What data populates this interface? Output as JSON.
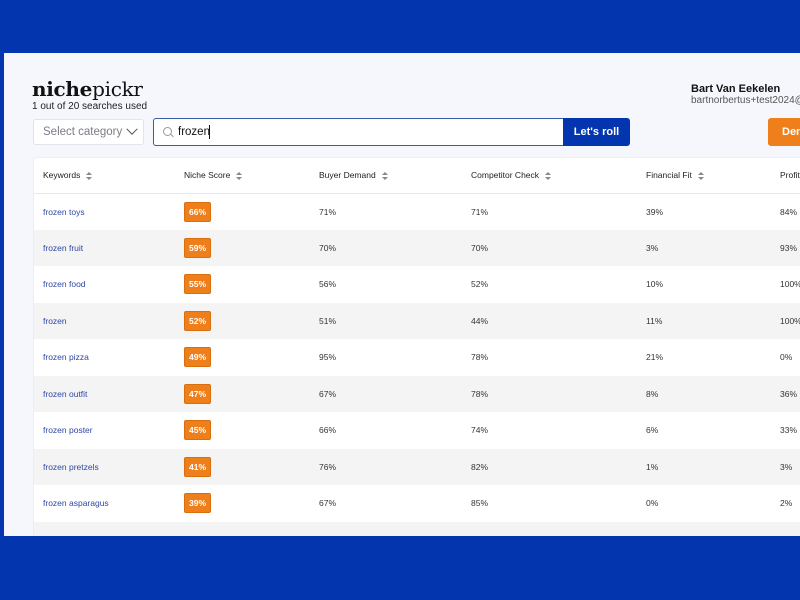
{
  "app": {
    "logo_bold": "niche",
    "logo_light": "pickr",
    "usage": "1 out of 20 searches used"
  },
  "user": {
    "name": "Bart Van Eekelen",
    "email": "bartnorbertus+test2024@"
  },
  "controls": {
    "category_placeholder": "Select category",
    "search_value": "frozen",
    "submit_label": "Let's roll",
    "demo_label": "Demo"
  },
  "colors": {
    "brand_blue": "#0336ae",
    "accent_orange": "#ef7f1a",
    "link_blue": "#2c47a3"
  },
  "table": {
    "columns": [
      "Keywords",
      "Niche Score",
      "Buyer Demand",
      "Competitor Check",
      "Financial Fit",
      "Profit"
    ],
    "rows": [
      {
        "keyword": "frozen toys",
        "niche_score": "66%",
        "buyer_demand": "71%",
        "competitor_check": "71%",
        "financial_fit": "39%",
        "profit": "84%"
      },
      {
        "keyword": "frozen fruit",
        "niche_score": "59%",
        "buyer_demand": "70%",
        "competitor_check": "70%",
        "financial_fit": "3%",
        "profit": "93%"
      },
      {
        "keyword": "frozen food",
        "niche_score": "55%",
        "buyer_demand": "56%",
        "competitor_check": "52%",
        "financial_fit": "10%",
        "profit": "100%"
      },
      {
        "keyword": "frozen",
        "niche_score": "52%",
        "buyer_demand": "51%",
        "competitor_check": "44%",
        "financial_fit": "11%",
        "profit": "100%"
      },
      {
        "keyword": "frozen pizza",
        "niche_score": "49%",
        "buyer_demand": "95%",
        "competitor_check": "78%",
        "financial_fit": "21%",
        "profit": "0%"
      },
      {
        "keyword": "frozen outfit",
        "niche_score": "47%",
        "buyer_demand": "67%",
        "competitor_check": "78%",
        "financial_fit": "8%",
        "profit": "36%"
      },
      {
        "keyword": "frozen poster",
        "niche_score": "45%",
        "buyer_demand": "66%",
        "competitor_check": "74%",
        "financial_fit": "6%",
        "profit": "33%"
      },
      {
        "keyword": "frozen pretzels",
        "niche_score": "41%",
        "buyer_demand": "76%",
        "competitor_check": "82%",
        "financial_fit": "1%",
        "profit": "3%"
      },
      {
        "keyword": "frozen asparagus",
        "niche_score": "39%",
        "buyer_demand": "67%",
        "competitor_check": "85%",
        "financial_fit": "0%",
        "profit": "2%"
      },
      {
        "keyword": "",
        "niche_score": "",
        "buyer_demand": "",
        "competitor_check": "",
        "financial_fit": "",
        "profit": ""
      }
    ]
  }
}
